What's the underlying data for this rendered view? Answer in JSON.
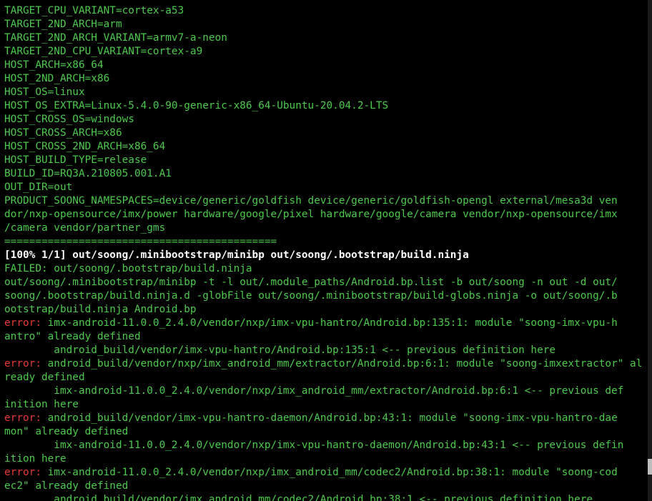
{
  "terminal": {
    "lines": [
      "TARGET_CPU_VARIANT=cortex-a53",
      "TARGET_2ND_ARCH=arm",
      "TARGET_2ND_ARCH_VARIANT=armv7-a-neon",
      "TARGET_2ND_CPU_VARIANT=cortex-a9",
      "HOST_ARCH=x86_64",
      "HOST_2ND_ARCH=x86",
      "HOST_OS=linux",
      "HOST_OS_EXTRA=Linux-5.4.0-90-generic-x86_64-Ubuntu-20.04.2-LTS",
      "HOST_CROSS_OS=windows",
      "HOST_CROSS_ARCH=x86",
      "HOST_CROSS_2ND_ARCH=x86_64",
      "HOST_BUILD_TYPE=release",
      "BUILD_ID=RQ3A.210805.001.A1",
      "OUT_DIR=out",
      "PRODUCT_SOONG_NAMESPACES=device/generic/goldfish device/generic/goldfish-opengl external/mesa3d ven",
      "dor/nxp-opensource/imx/power hardware/google/pixel hardware/google/camera vendor/nxp-opensource/imx",
      "/camera vendor/partner_gms",
      "============================================",
      "[100% 1/1] out/soong/.minibootstrap/minibp out/soong/.bootstrap/build.ninja",
      "FAILED: out/soong/.bootstrap/build.ninja",
      "out/soong/.minibootstrap/minibp -t -l out/.module_paths/Android.bp.list -b out/soong -n out -d out/",
      "soong/.bootstrap/build.ninja.d -globFile out/soong/.minibootstrap/build-globs.ninja -o out/soong/.b",
      "ootstrap/build.ninja Android.bp"
    ],
    "error_label": "error:",
    "errors": [
      {
        "text": " imx-android-11.0.0_2.4.0/vendor/nxp/imx-vpu-hantro/Android.bp:135:1: module \"soong-imx-vpu-h",
        "cont": "antro\" already defined",
        "prev": "        android_build/vendor/imx-vpu-hantro/Android.bp:135:1 <-- previous definition here",
        "prev_cont": ""
      },
      {
        "text": " android_build/vendor/nxp/imx_android_mm/extractor/Android.bp:6:1: module \"soong-imxextractor\" al",
        "cont": "ready defined",
        "prev": "        imx-android-11.0.0_2.4.0/vendor/nxp/imx_android_mm/extractor/Android.bp:6:1 <-- previous def",
        "prev_cont": "inition here"
      },
      {
        "text": " android_build/vendor/imx-vpu-hantro-daemon/Android.bp:43:1: module \"soong-imx-vpu-hantro-dae",
        "cont": "mon\" already defined",
        "prev": "        imx-android-11.0.0_2.4.0/vendor/nxp/imx-vpu-hantro-daemon/Android.bp:43:1 <-- previous defin",
        "prev_cont": "ition here"
      },
      {
        "text": " imx-android-11.0.0_2.4.0/vendor/nxp/imx_android_mm/codec2/Android.bp:38:1: module \"soong-cod",
        "cont": "ec2\" already defined",
        "prev": "        android_build/vendor/imx_android_mm/codec2/Android.bp:38:1 <-- previous definition here",
        "prev_cont": ""
      }
    ]
  },
  "colors": {
    "background": "#000000",
    "text": "#4ec94e",
    "bright": "#ffffff",
    "error": "#e23a3a"
  }
}
